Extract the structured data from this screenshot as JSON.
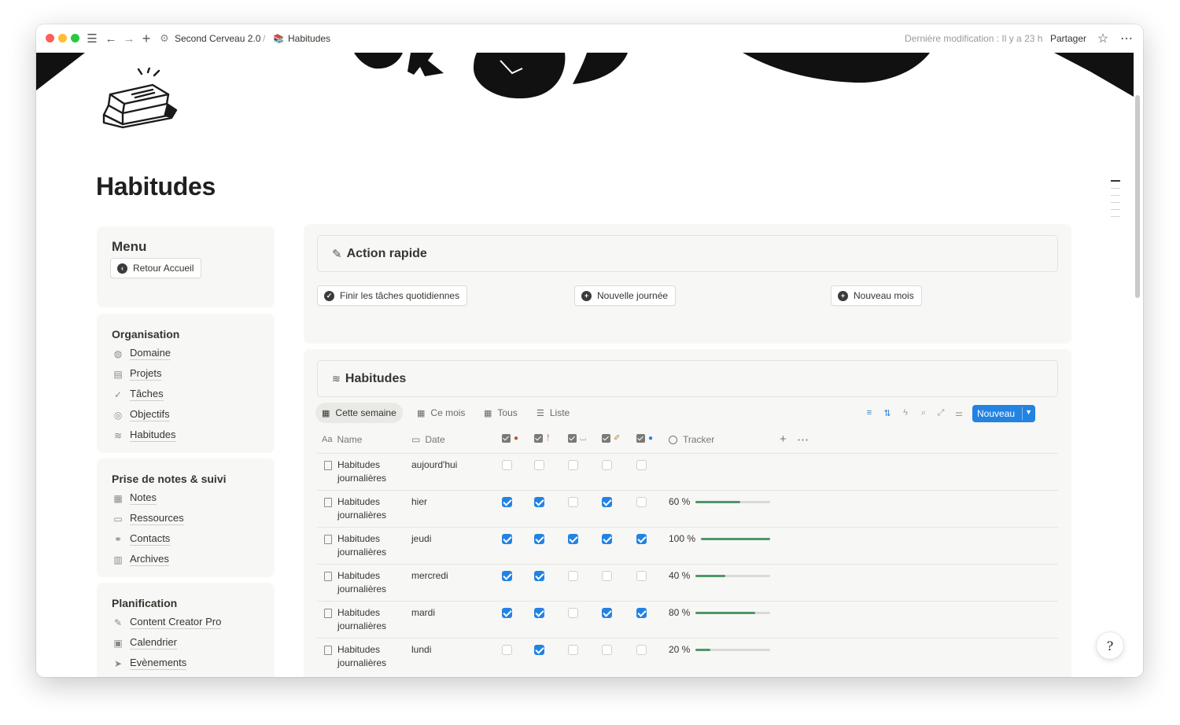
{
  "topbar": {
    "workspace": "Second Cerveau 2.0",
    "separator": "/",
    "page": "Habitudes",
    "last_modified": "Dernière modification : Il y a 23 h",
    "share": "Partager"
  },
  "page": {
    "title": "Habitudes"
  },
  "menu": {
    "title": "Menu",
    "back_button": "Retour Accueil",
    "sections": [
      {
        "title": "Organisation",
        "items": [
          "Domaine",
          "Projets",
          "Tâches",
          "Objectifs",
          "Habitudes"
        ]
      },
      {
        "title": "Prise de notes & suivi",
        "items": [
          "Notes",
          "Ressources",
          "Contacts",
          "Archives"
        ]
      },
      {
        "title": "Planification",
        "items": [
          "Content Creator Pro",
          "Calendrier",
          "Evènements"
        ]
      }
    ]
  },
  "quick_action": {
    "title": "Action rapide",
    "buttons": [
      "Finir les tâches quotidiennes",
      "Nouvelle journée",
      "Nouveau mois"
    ]
  },
  "habits": {
    "title": "Habitudes",
    "views": [
      "Cette semaine",
      "Ce mois",
      "Tous",
      "Liste"
    ],
    "new_button": "Nouveau",
    "columns": {
      "name": "Name",
      "date": "Date",
      "tracker": "Tracker"
    },
    "rows": [
      {
        "name_line1": "Habitudes",
        "name_line2": "journalières",
        "date": "aujourd'hui",
        "checks": [
          false,
          false,
          false,
          false,
          false
        ],
        "tracker": "",
        "progress": null
      },
      {
        "name_line1": "Habitudes",
        "name_line2": "journalières",
        "date": "hier",
        "checks": [
          true,
          true,
          false,
          true,
          false
        ],
        "tracker": "60 %",
        "progress": 0.6
      },
      {
        "name_line1": "Habitudes",
        "name_line2": "journalières",
        "date": "jeudi",
        "checks": [
          true,
          true,
          true,
          true,
          true
        ],
        "tracker": "100 %",
        "progress": 1.0
      },
      {
        "name_line1": "Habitudes",
        "name_line2": "journalières",
        "date": "mercredi",
        "checks": [
          true,
          true,
          false,
          false,
          false
        ],
        "tracker": "40 %",
        "progress": 0.4
      },
      {
        "name_line1": "Habitudes",
        "name_line2": "journalières",
        "date": "mardi",
        "checks": [
          true,
          true,
          false,
          true,
          true
        ],
        "tracker": "80 %",
        "progress": 0.8
      },
      {
        "name_line1": "Habitudes",
        "name_line2": "journalières",
        "date": "lundi",
        "checks": [
          false,
          true,
          false,
          false,
          false
        ],
        "tracker": "20 %",
        "progress": 0.2
      }
    ]
  },
  "colors": {
    "accent": "#2383e2",
    "progress": "#4f9768",
    "card_bg": "#f7f7f5"
  },
  "icons": [
    "menu-icon",
    "back-arrow-icon",
    "forward-arrow-icon",
    "plus-icon",
    "settings-icon",
    "star-icon",
    "more-icon",
    "filter-icon",
    "sort-icon",
    "lightning-icon",
    "search-icon",
    "expand-icon",
    "settings-sliders-icon",
    "help-icon"
  ]
}
